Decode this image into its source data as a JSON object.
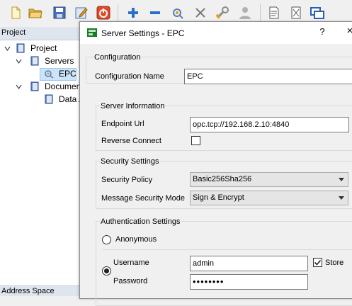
{
  "toolbar": {
    "icons": [
      "new-file-icon",
      "open-folder-icon",
      "save-icon",
      "edit-icon",
      "power-icon",
      "add-icon",
      "remove-icon",
      "connect-icon",
      "disconnect-icon",
      "settings-wrench-icon",
      "user-icon",
      "document-icon",
      "clear-icon",
      "windows-icon"
    ]
  },
  "project_panel": {
    "header": "Project",
    "tree": [
      {
        "label": "Project"
      },
      {
        "label": "Servers"
      },
      {
        "label": "EPC"
      },
      {
        "label": "Documen"
      },
      {
        "label": "Data A"
      }
    ],
    "address_space_header": "Address Space"
  },
  "dialog": {
    "title": "Server Settings - EPC",
    "help": "?",
    "close": "×",
    "configuration": {
      "group_title": "Configuration",
      "name_label": "Configuration Name",
      "name_value": "EPC"
    },
    "server_information": {
      "group_title": "Server Information",
      "endpoint_label": "Endpoint Url",
      "endpoint_value": "opc.tcp://192.168.2.10:4840",
      "reverse_label": "Reverse Connect",
      "reverse_checked": false
    },
    "security": {
      "group_title": "Security Settings",
      "policy_label": "Security Policy",
      "policy_value": "Basic256Sha256",
      "mode_label": "Message Security Mode",
      "mode_value": "Sign & Encrypt"
    },
    "authentication": {
      "group_title": "Authentication Settings",
      "anonymous_label": "Anonymous",
      "anonymous_selected": false,
      "username_selected": true,
      "username_label": "Username",
      "username_value": "admin",
      "store_label": "Store",
      "store_checked": true,
      "password_label": "Password",
      "password_value": "••••••••"
    }
  }
}
